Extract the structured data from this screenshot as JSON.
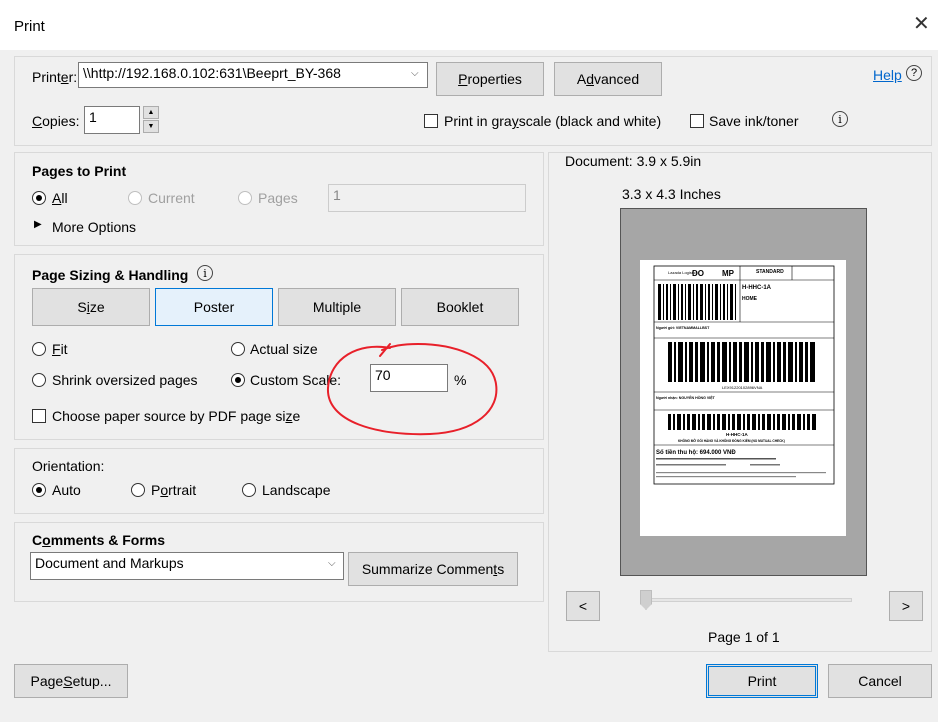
{
  "window": {
    "title": "Print",
    "close_glyph": "✕"
  },
  "printer": {
    "label_pre": "Print",
    "label_key": "e",
    "label_post": "r:",
    "value": "\\\\http://192.168.0.102:631\\Beeprt_BY-368",
    "properties_key": "P",
    "properties_rest": "roperties",
    "advanced_pre": "A",
    "advanced_key": "d",
    "advanced_rest": "vanced",
    "help_label": "Help",
    "help_icon_glyph": "?"
  },
  "copies": {
    "label_key": "C",
    "label_rest": "opies:",
    "value": "1",
    "up_glyph": "▲",
    "down_glyph": "▼"
  },
  "options": {
    "grayscale_pre": "Print in gra",
    "grayscale_key": "y",
    "grayscale_post": "scale (black and white)",
    "save_ink_label": "Save ink/toner",
    "info_glyph": "i"
  },
  "pages_to_print": {
    "heading": "Pages to Print",
    "all_key": "A",
    "all_rest": "ll",
    "current_label": "Current",
    "pages_label": "Pages",
    "pages_value": "1",
    "more_options_arrow": "▶",
    "more_options_label": "More Options"
  },
  "sizing": {
    "heading": "Page Sizing & Handling",
    "info_glyph": "i",
    "tabs": [
      {
        "pre": "S",
        "key": "i",
        "post": "ze"
      },
      {
        "pre": "",
        "key": "",
        "post": "Poster"
      },
      {
        "pre": "",
        "key": "",
        "post": "Multiple"
      },
      {
        "pre": "",
        "key": "",
        "post": "Booklet"
      }
    ],
    "fit_key": "F",
    "fit_rest": "it",
    "actual_size_label": "Actual size",
    "shrink_label": "Shrink oversized pages",
    "custom_scale_label": "Custom Scale:",
    "scale_value": "70",
    "percent": "%",
    "paper_source_pre": "Choose paper source by PDF page si",
    "paper_source_key": "z",
    "paper_source_post": "e"
  },
  "orientation": {
    "heading": "Orientation:",
    "auto_label": "Auto",
    "portrait_pre": "P",
    "portrait_key": "o",
    "portrait_post": "rtrait",
    "landscape_label": "Landscape"
  },
  "comments": {
    "heading_key": "C",
    "heading_pre": "o",
    "heading_rest": "mments & Forms",
    "value": "Document and Markups",
    "summarize_pre": "Summarize Commen",
    "summarize_key": "t",
    "summarize_post": "s"
  },
  "preview": {
    "document_size": "Document: 3.9 x 5.9in",
    "page_size": "3.3 x 4.3 Inches",
    "prev_glyph": "<",
    "next_glyph": ">",
    "page_indicator": "Page 1 of 1"
  },
  "label": {
    "logo_text": "Lazada Logistics",
    "code_do": "DO",
    "code_mp": "MP",
    "standard": "STANDARD",
    "hub": "H-HHC-1A",
    "home": "HOME",
    "sender_line": "Người gửi: VIETNAMMALLBST",
    "receiver_line": "Người nhận: NGUYỄN HỒNG VIỆT",
    "tracking": "LEX91220102896VNA",
    "hub_bottom": "H-HHC-1A",
    "warning": "KHÔNG MỞ GÓI HÀNG VÀ KHÔNG ĐỒNG KIỂM (NO MUTUAL CHECK)",
    "cod": "Số tiền thu hộ: 694.000 VNĐ"
  },
  "footer": {
    "page_setup_pre": "Page ",
    "page_setup_key": "S",
    "page_setup_post": "etup...",
    "print_label": "Print",
    "cancel_label": "Cancel"
  },
  "colors": {
    "annotation": "#e8202a",
    "accent": "#0078d7"
  }
}
